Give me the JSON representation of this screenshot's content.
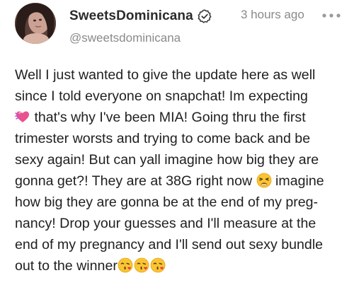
{
  "post": {
    "author": {
      "display_name": "SweetsDominicana",
      "handle": "@sweetsdominicana",
      "verified_icon": "verified-badge-icon",
      "avatar_icon": "avatar-photo"
    },
    "timestamp": "3 hours ago",
    "more_icon": "more-options-icon",
    "body_lines": [
      "Well I just wanted to give the update here as well",
      "since I told everyone on snapchat! Im expecting",
      " that's why I've been MIA! Going thru the first",
      "trimester worsts and trying to come back and be",
      "sexy again! But can yall imagine how big they are",
      "gonna get?! They are at 38G right now ",
      " imagine",
      "how big they are gonna be at the end of my preg-",
      "nancy! Drop your guesses and I'll measure at the",
      "end of my pregnancy and I'll send out sexy bundle",
      "out to the winner"
    ],
    "emojis": {
      "heart": "growing-heart-emoji",
      "tired": "tired-face-emoji",
      "kiss": "face-blowing-kiss-emoji"
    }
  },
  "colors": {
    "text": "#1f1f1f",
    "muted": "#8a8a8a",
    "heart": "#e8528f",
    "emoji_yellow": "#fbc531"
  }
}
